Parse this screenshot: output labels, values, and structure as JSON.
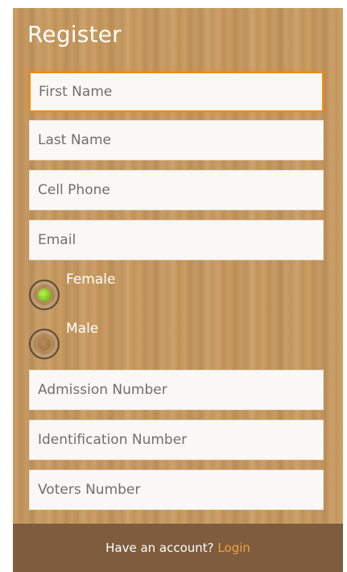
{
  "header": {
    "title": "Register"
  },
  "form": {
    "first_name": {
      "placeholder": "First Name",
      "value": ""
    },
    "last_name": {
      "placeholder": "Last Name",
      "value": ""
    },
    "cell_phone": {
      "placeholder": "Cell Phone",
      "value": ""
    },
    "email": {
      "placeholder": "Email",
      "value": ""
    },
    "gender": {
      "options": [
        {
          "label": "Female",
          "selected": true
        },
        {
          "label": "Male",
          "selected": false
        }
      ]
    },
    "admission_number": {
      "placeholder": "Admission Number",
      "value": ""
    },
    "identification_number": {
      "placeholder": "Identification Number",
      "value": ""
    },
    "voters_number": {
      "placeholder": "Voters Number",
      "value": ""
    }
  },
  "footer": {
    "prompt": "Have an account?",
    "link_label": "Login"
  },
  "colors": {
    "background_wood": "#c8995e",
    "footer_bar": "#7e5d3e",
    "link": "#f0a040",
    "focus_border": "#f08a16",
    "radio_selected": "#7ccb1d"
  }
}
